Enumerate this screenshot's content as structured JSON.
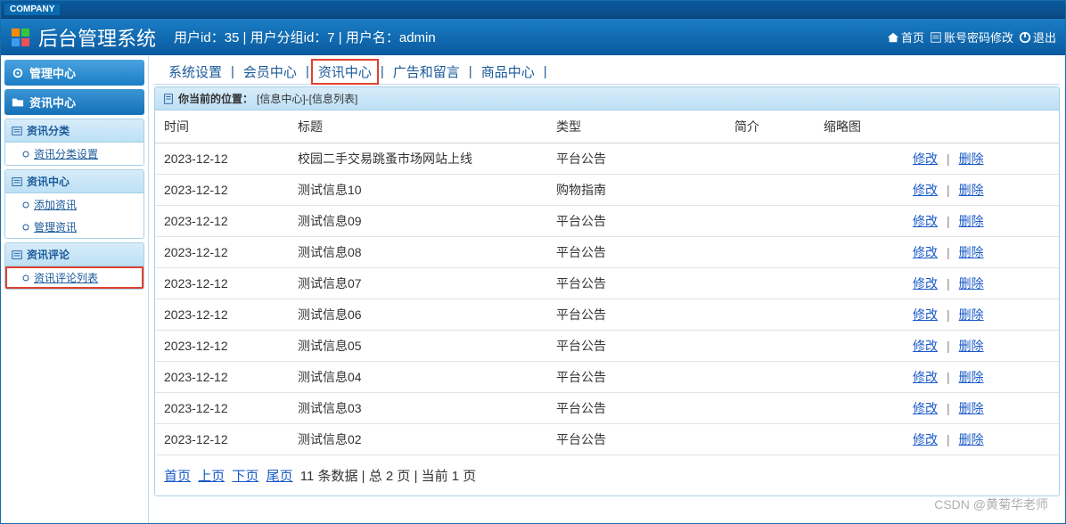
{
  "company_tag": "COMPANY",
  "app_title": "后台管理系统",
  "user_line": "用户id：35 | 用户分组id：7 | 用户名：admin",
  "header_links": {
    "home": "首页",
    "pwd": "账号密码修改",
    "logout": "退出"
  },
  "sidebar": {
    "main_head": "管理中心",
    "section_head": "资讯中心",
    "blocks": [
      {
        "title": "资讯分类",
        "items": [
          {
            "label": "资讯分类设置",
            "hl": false
          }
        ]
      },
      {
        "title": "资讯中心",
        "items": [
          {
            "label": "添加资讯",
            "hl": false
          },
          {
            "label": "管理资讯",
            "hl": false
          }
        ]
      },
      {
        "title": "资讯评论",
        "items": [
          {
            "label": "资讯评论列表",
            "hl": true
          }
        ]
      }
    ]
  },
  "topnav": [
    {
      "label": "系统设置",
      "active": false
    },
    {
      "label": "会员中心",
      "active": false
    },
    {
      "label": "资讯中心",
      "active": true
    },
    {
      "label": "广告和留言",
      "active": false
    },
    {
      "label": "商品中心",
      "active": false
    }
  ],
  "breadcrumb": {
    "prefix": "你当前的位置：",
    "path": "[信息中心]-[信息列表]"
  },
  "table": {
    "headers": [
      "时间",
      "标题",
      "类型",
      "简介",
      "缩略图",
      ""
    ],
    "edit": "修改",
    "del": "删除",
    "rows": [
      {
        "date": "2023-12-12",
        "title": "校园二手交易跳蚤市场网站上线",
        "type": "平台公告",
        "intro": "",
        "thumb": ""
      },
      {
        "date": "2023-12-12",
        "title": "测试信息10",
        "type": "购物指南",
        "intro": "",
        "thumb": ""
      },
      {
        "date": "2023-12-12",
        "title": "测试信息09",
        "type": "平台公告",
        "intro": "",
        "thumb": ""
      },
      {
        "date": "2023-12-12",
        "title": "测试信息08",
        "type": "平台公告",
        "intro": "",
        "thumb": ""
      },
      {
        "date": "2023-12-12",
        "title": "测试信息07",
        "type": "平台公告",
        "intro": "",
        "thumb": ""
      },
      {
        "date": "2023-12-12",
        "title": "测试信息06",
        "type": "平台公告",
        "intro": "",
        "thumb": ""
      },
      {
        "date": "2023-12-12",
        "title": "测试信息05",
        "type": "平台公告",
        "intro": "",
        "thumb": ""
      },
      {
        "date": "2023-12-12",
        "title": "测试信息04",
        "type": "平台公告",
        "intro": "",
        "thumb": ""
      },
      {
        "date": "2023-12-12",
        "title": "测试信息03",
        "type": "平台公告",
        "intro": "",
        "thumb": ""
      },
      {
        "date": "2023-12-12",
        "title": "测试信息02",
        "type": "平台公告",
        "intro": "",
        "thumb": ""
      }
    ]
  },
  "pager": {
    "first": "首页",
    "prev": "上页",
    "next": "下页",
    "last": "尾页",
    "info": "11 条数据 | 总 2 页 | 当前 1 页"
  },
  "watermark": "CSDN @黄菊华老师"
}
